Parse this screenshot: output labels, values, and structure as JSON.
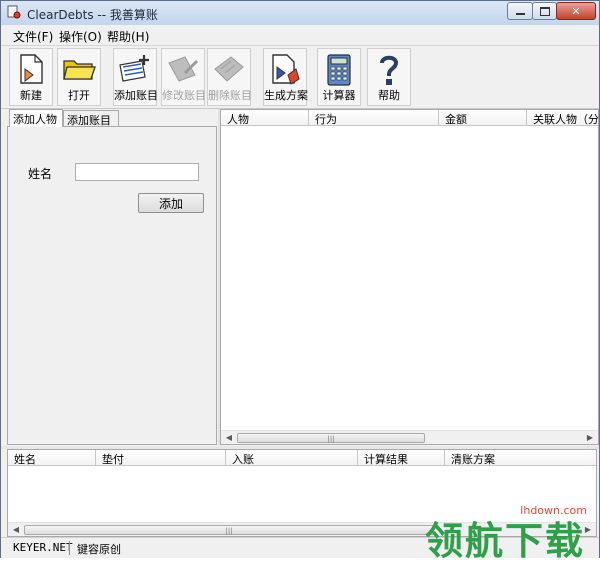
{
  "window": {
    "title": "ClearDebts -- 我善算账",
    "controls": {
      "minimize_icon": "minimize-icon",
      "maximize_icon": "maximize-icon",
      "close_icon": "close-icon"
    }
  },
  "menu": {
    "items": [
      {
        "label": "文件(F)"
      },
      {
        "label": "操作(O)"
      },
      {
        "label": "帮助(H)"
      }
    ]
  },
  "toolbar": {
    "buttons": [
      {
        "label": "新建",
        "icon": "new-document-icon",
        "enabled": true
      },
      {
        "label": "打开",
        "icon": "open-folder-icon",
        "enabled": true
      },
      {
        "label": "添加账目",
        "icon": "add-entry-icon",
        "enabled": true
      },
      {
        "label": "修改账目",
        "icon": "edit-entry-icon",
        "enabled": false
      },
      {
        "label": "删除账目",
        "icon": "delete-entry-icon",
        "enabled": false
      },
      {
        "label": "生成方案",
        "icon": "generate-plan-icon",
        "enabled": true
      },
      {
        "label": "计算器",
        "icon": "calculator-icon",
        "enabled": true
      },
      {
        "label": "帮助",
        "icon": "help-icon",
        "enabled": true
      }
    ]
  },
  "left_panel": {
    "tabs": [
      {
        "label": "添加人物"
      },
      {
        "label": "添加账目"
      }
    ],
    "active_tab": "添加人物",
    "name_label": "姓名",
    "name_value": "",
    "add_button": "添加"
  },
  "entries_table": {
    "columns": [
      "人物",
      "行为",
      "金额",
      "关联人物（分"
    ],
    "rows": []
  },
  "summary_table": {
    "columns": [
      "姓名",
      "垫付",
      "入账",
      "计算结果",
      "清账方案"
    ],
    "rows": []
  },
  "statusbar": {
    "left": "KEYER.NET",
    "right": "键容原创"
  },
  "watermark": {
    "text": "领航下载",
    "url": "lhdown.com"
  },
  "colors": {
    "brand_green": "#2fa04a",
    "close_red": "#c6402c"
  }
}
